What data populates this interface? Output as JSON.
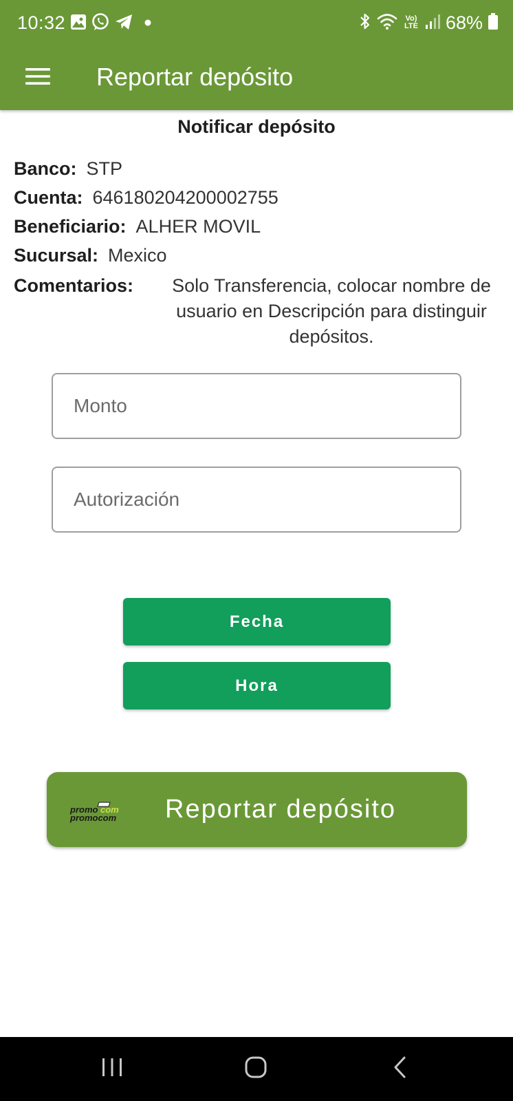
{
  "status_bar": {
    "time": "10:32",
    "battery_percent": "68%",
    "volte_top": "Vo)",
    "volte_bottom": "LTE",
    "left_icons": [
      "gallery-icon",
      "whatsapp-icon",
      "telegram-icon",
      "notification-dot-icon"
    ],
    "right_icons": [
      "bluetooth-icon",
      "wifi-icon",
      "volte-icon",
      "signal-icon",
      "battery-icon"
    ]
  },
  "app_bar": {
    "title": "Reportar depósito",
    "menu_icon": "hamburger-menu-icon",
    "background_color": "#6a9837"
  },
  "deposit_info": {
    "section_title": "Notificar depósito",
    "fields": [
      {
        "label": "Banco:",
        "value": "STP"
      },
      {
        "label": "Cuenta:",
        "value": "646180204200002755"
      },
      {
        "label": "Beneficiario:",
        "value": "ALHER MOVIL"
      },
      {
        "label": "Sucursal:",
        "value": "Mexico"
      }
    ],
    "comments": {
      "label": "Comentarios:",
      "value": "Solo Transferencia, colocar nombre de usuario en Descripción para distinguir depósitos."
    }
  },
  "form": {
    "amount": {
      "placeholder": "Monto",
      "value": ""
    },
    "authorization": {
      "placeholder": "Autorización",
      "value": ""
    },
    "date_button_label": "Fecha",
    "time_button_label": "Hora",
    "button_color": "#129e5b"
  },
  "report_button": {
    "label": "Reportar depósito",
    "logo_text": "promocom"
  },
  "nav_bar": {
    "icons": [
      "recent-apps-icon",
      "home-icon",
      "back-icon"
    ]
  }
}
